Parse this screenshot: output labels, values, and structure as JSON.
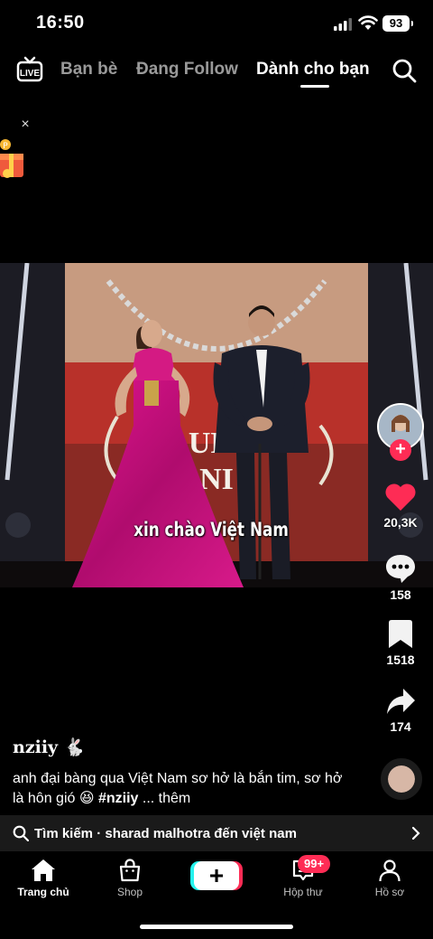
{
  "status_bar": {
    "time": "16:50",
    "battery": "93"
  },
  "top_nav": {
    "live_icon": "live-tv-icon",
    "tabs": [
      {
        "label": "Bạn bè",
        "active": false
      },
      {
        "label": "Đang Follow",
        "active": false
      },
      {
        "label": "Dành cho bạn",
        "active": true
      }
    ],
    "search_icon": "search-icon"
  },
  "promo": {
    "close_label": "×",
    "icon": "gift-box-icon"
  },
  "video": {
    "caption": "xin chào Việt Nam"
  },
  "actions": {
    "likes": "20,3K",
    "comments": "158",
    "saves": "1518",
    "shares": "174"
  },
  "post": {
    "username": "nziiy 🐇",
    "description": "anh đại bàng qua Việt Nam sơ hở là bắn tim, sơ hở là hôn gió 😆 ",
    "hashtag": "#nziiy",
    "more": " ... thêm"
  },
  "search_suggestion": {
    "label": "Tìm kiếm · sharad malhotra đến việt nam"
  },
  "bottom_nav": {
    "home": "Trang chủ",
    "shop": "Shop",
    "create": "+",
    "inbox": "Hộp thư",
    "inbox_badge": "99+",
    "profile": "Hồ sơ"
  },
  "colors": {
    "accent": "#fe2c55",
    "cyan": "#25f4ee",
    "like": "#fe2c55"
  }
}
